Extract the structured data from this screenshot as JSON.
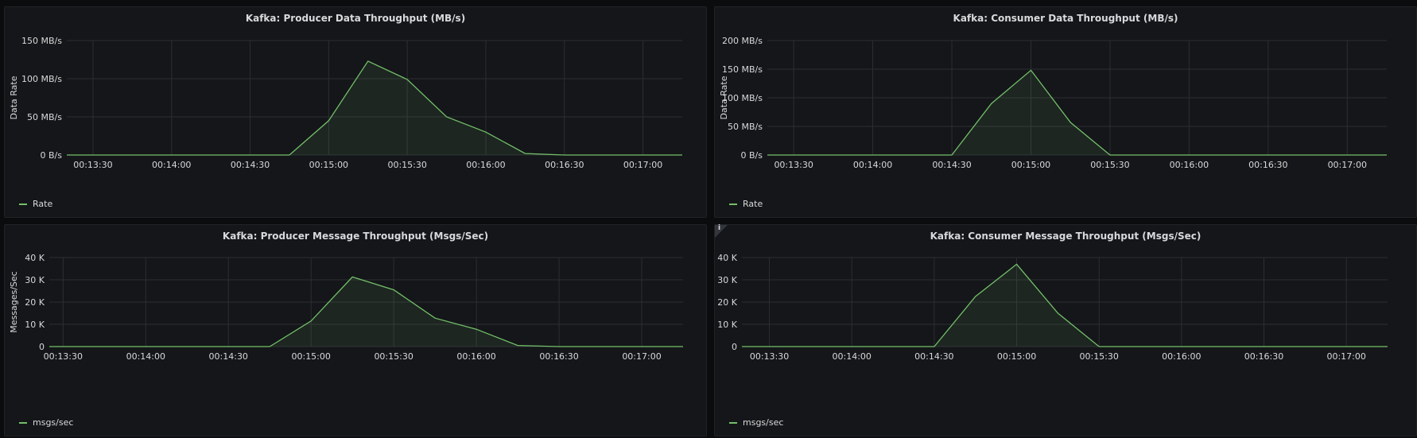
{
  "colors": {
    "background": "#0b0c0e",
    "panel": "#141619",
    "grid": "#2c2e33",
    "text": "#d8d9da",
    "series": "#73bf69"
  },
  "info_icon": {
    "glyph": "i",
    "icon": "info-icon"
  },
  "chart_data": [
    {
      "type": "area",
      "title": "Kafka: Producer Data Throughput (MB/s)",
      "ylabel": "Data Rate",
      "ylim": [
        0,
        150
      ],
      "yticks": [
        0,
        50,
        100,
        150
      ],
      "ytick_labels": [
        "0 B/s",
        "50 MB/s",
        "100 MB/s",
        "150 MB/s"
      ],
      "x_time_labels": [
        "00:13:30",
        "00:14:00",
        "00:14:30",
        "00:15:00",
        "00:15:30",
        "00:16:00",
        "00:16:30",
        "00:17:00"
      ],
      "series": [
        {
          "name": "Rate",
          "points": [
            [
              "00:13:20",
              0
            ],
            [
              "00:14:45",
              0
            ],
            [
              "00:15:00",
              45
            ],
            [
              "00:15:15",
              123
            ],
            [
              "00:15:30",
              99
            ],
            [
              "00:15:45",
              50
            ],
            [
              "00:16:00",
              30
            ],
            [
              "00:16:15",
              2
            ],
            [
              "00:16:30",
              0
            ],
            [
              "00:17:00",
              0
            ],
            [
              "00:17:15",
              0
            ]
          ]
        }
      ],
      "legend": "Rate"
    },
    {
      "type": "area",
      "title": "Kafka: Consumer Data Throughput (MB/s)",
      "ylabel": "Data Rate",
      "ylim": [
        0,
        200
      ],
      "yticks": [
        0,
        50,
        100,
        150,
        200
      ],
      "ytick_labels": [
        "0 B/s",
        "50 MB/s",
        "100 MB/s",
        "150 MB/s",
        "200 MB/s"
      ],
      "x_time_labels": [
        "00:13:30",
        "00:14:00",
        "00:14:30",
        "00:15:00",
        "00:15:30",
        "00:16:00",
        "00:16:30",
        "00:17:00"
      ],
      "series": [
        {
          "name": "Rate",
          "points": [
            [
              "00:13:20",
              0
            ],
            [
              "00:14:30",
              0
            ],
            [
              "00:14:45",
              90
            ],
            [
              "00:15:00",
              148
            ],
            [
              "00:15:15",
              57
            ],
            [
              "00:15:30",
              0
            ],
            [
              "00:16:00",
              0
            ],
            [
              "00:17:00",
              0
            ],
            [
              "00:17:15",
              0
            ]
          ]
        }
      ],
      "legend": "Rate"
    },
    {
      "type": "area",
      "title": "Kafka: Producer Message Throughput (Msgs/Sec)",
      "ylabel": "Messages/Sec",
      "ylim": [
        0,
        40000
      ],
      "yticks": [
        0,
        10000,
        20000,
        30000,
        40000
      ],
      "ytick_labels": [
        "0",
        "10 K",
        "20 K",
        "30 K",
        "40 K"
      ],
      "x_time_labels": [
        "00:13:30",
        "00:14:00",
        "00:14:30",
        "00:15:00",
        "00:15:30",
        "00:16:00",
        "00:16:30",
        "00:17:00"
      ],
      "series": [
        {
          "name": "msgs/sec",
          "points": [
            [
              "00:13:25",
              0
            ],
            [
              "00:14:45",
              0
            ],
            [
              "00:15:00",
              11500
            ],
            [
              "00:15:15",
              31300
            ],
            [
              "00:15:30",
              25500
            ],
            [
              "00:15:45",
              12800
            ],
            [
              "00:16:00",
              7800
            ],
            [
              "00:16:15",
              500
            ],
            [
              "00:16:30",
              0
            ],
            [
              "00:17:00",
              0
            ],
            [
              "00:17:15",
              0
            ]
          ]
        }
      ],
      "legend": "msgs/sec"
    },
    {
      "type": "area",
      "title": "Kafka: Consumer Message Throughput (Msgs/Sec)",
      "ylabel": "",
      "ylim": [
        0,
        40000
      ],
      "yticks": [
        0,
        10000,
        20000,
        30000,
        40000
      ],
      "ytick_labels": [
        "0",
        "10 K",
        "20 K",
        "30 K",
        "40 K"
      ],
      "x_time_labels": [
        "00:13:30",
        "00:14:00",
        "00:14:30",
        "00:15:00",
        "00:15:30",
        "00:16:00",
        "00:16:30",
        "00:17:00"
      ],
      "series": [
        {
          "name": "msgs/sec",
          "points": [
            [
              "00:13:20",
              0
            ],
            [
              "00:14:30",
              0
            ],
            [
              "00:14:45",
              22500
            ],
            [
              "00:15:00",
              37000
            ],
            [
              "00:15:15",
              15000
            ],
            [
              "00:15:30",
              0
            ],
            [
              "00:16:00",
              0
            ],
            [
              "00:17:00",
              0
            ],
            [
              "00:17:15",
              0
            ]
          ]
        }
      ],
      "legend": "msgs/sec"
    }
  ]
}
